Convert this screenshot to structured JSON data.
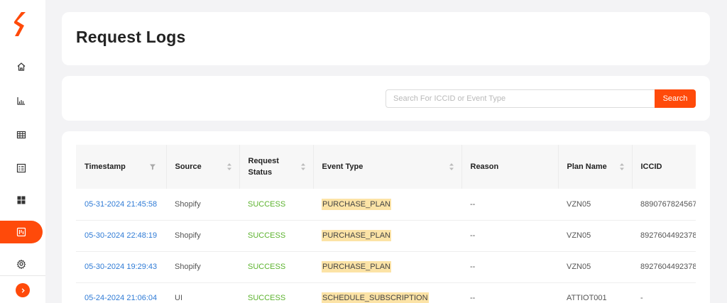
{
  "page": {
    "title": "Request Logs"
  },
  "brand": {
    "accent": "#ff4a0a",
    "link": "#2f7bd6",
    "success": "#5cb32e",
    "highlight": "#fce3a6"
  },
  "sidebar": {
    "items": [
      {
        "name": "home",
        "icon": "home-icon"
      },
      {
        "name": "analytics",
        "icon": "bar-chart-icon"
      },
      {
        "name": "table",
        "icon": "table-grid-icon"
      },
      {
        "name": "list",
        "icon": "list-box-icon"
      },
      {
        "name": "dashboard",
        "icon": "dashboard-icon"
      },
      {
        "name": "request-logs",
        "icon": "logs-icon",
        "active": true
      },
      {
        "name": "settings",
        "icon": "gear-icon"
      }
    ],
    "expand_icon": "chevron-right-icon"
  },
  "search": {
    "placeholder": "Search For ICCID or Event Type",
    "value": "",
    "button_label": "Search"
  },
  "table": {
    "columns": [
      "Timestamp",
      "Source",
      "Request Status",
      "Event Type",
      "Reason",
      "Plan Name",
      "ICCID"
    ],
    "rows": [
      {
        "timestamp": "05-31-2024 21:45:58",
        "source": "Shopify",
        "status": "SUCCESS",
        "event_type": "PURCHASE_PLAN",
        "reason": "--",
        "plan_name": "VZN05",
        "iccid": "8890767824567"
      },
      {
        "timestamp": "05-30-2024 22:48:19",
        "source": "Shopify",
        "status": "SUCCESS",
        "event_type": "PURCHASE_PLAN",
        "reason": "--",
        "plan_name": "VZN05",
        "iccid": "8927604492378"
      },
      {
        "timestamp": "05-30-2024 19:29:43",
        "source": "Shopify",
        "status": "SUCCESS",
        "event_type": "PURCHASE_PLAN",
        "reason": "--",
        "plan_name": "VZN05",
        "iccid": "8927604492378"
      },
      {
        "timestamp": "05-24-2024 21:06:04",
        "source": "UI",
        "status": "SUCCESS",
        "event_type": "SCHEDULE_SUBSCRIPTION",
        "reason": "--",
        "plan_name": "ATTIOT001",
        "iccid": "-"
      }
    ]
  }
}
